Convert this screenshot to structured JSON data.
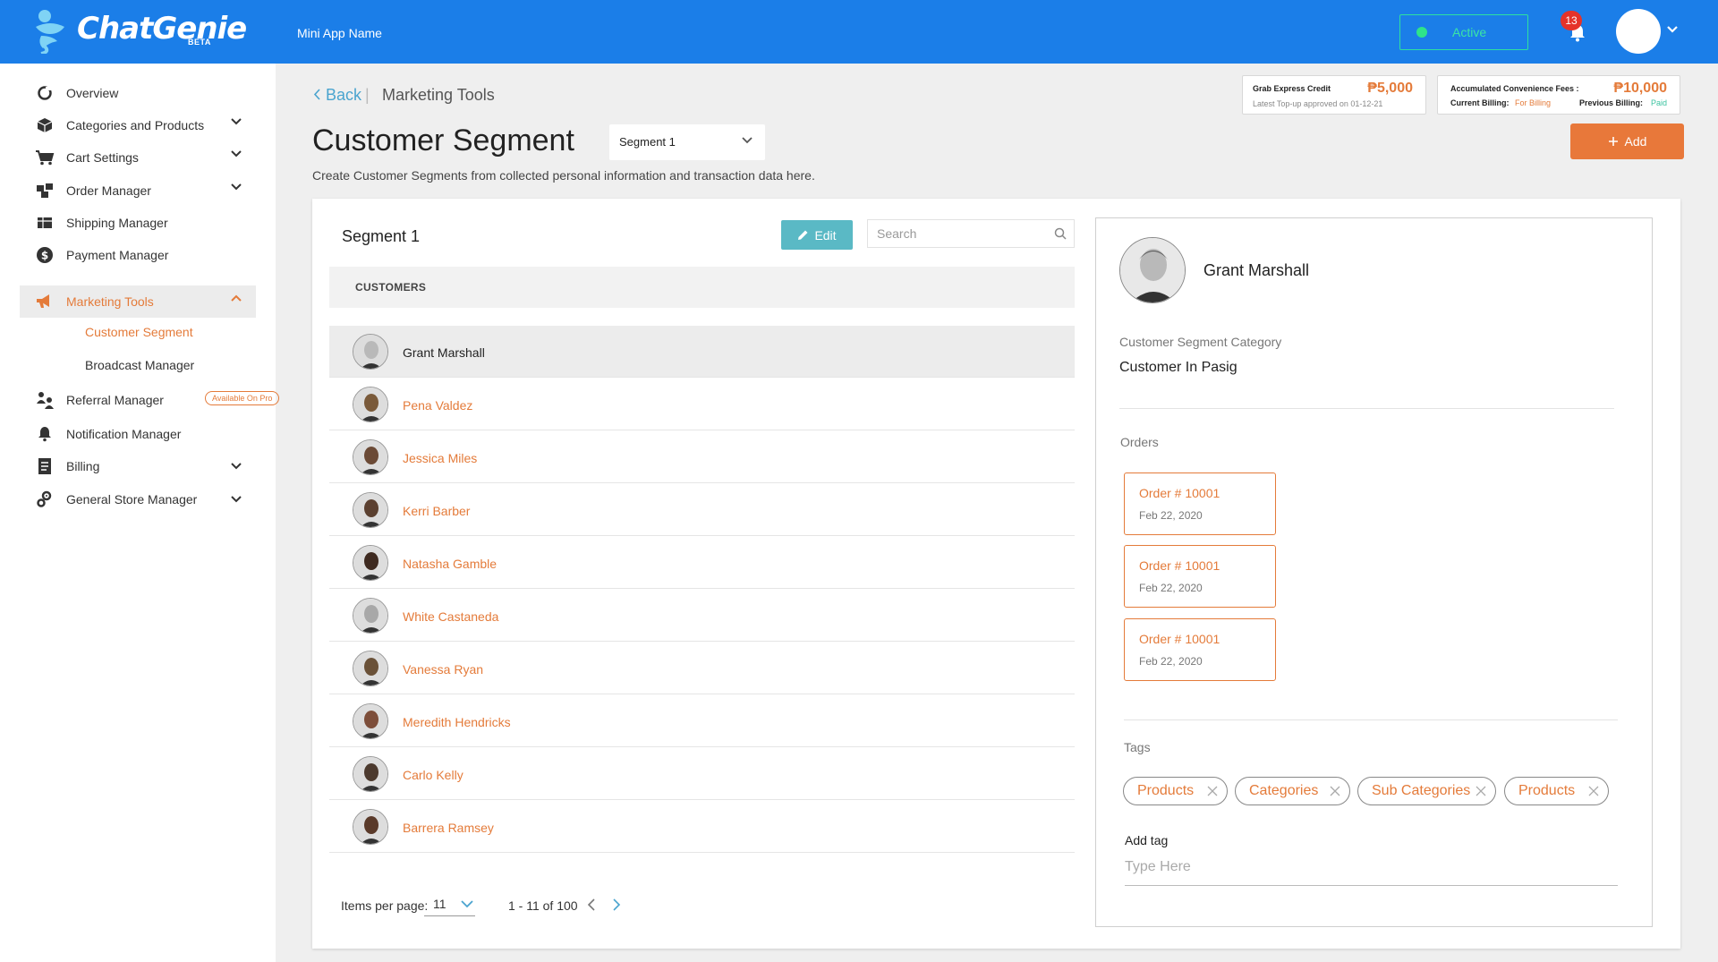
{
  "header": {
    "brand": "ChatGenie",
    "brand_badge": "BETA",
    "app_name": "Mini App Name",
    "status": "Active",
    "notification_count": "13",
    "colors": {
      "bar": "#1b7ee8",
      "status": "#2ee48a",
      "badge": "#e5332a"
    }
  },
  "sidebar": {
    "items": [
      {
        "label": "Overview",
        "icon": "overview-icon"
      },
      {
        "label": "Categories and Products",
        "icon": "box-icon"
      },
      {
        "label": "Cart Settings",
        "icon": "cart-icon"
      },
      {
        "label": "Order Manager",
        "icon": "orders-icon"
      },
      {
        "label": "Shipping Manager",
        "icon": "shipping-icon"
      },
      {
        "label": "Payment Manager",
        "icon": "payment-icon"
      },
      {
        "label": "Marketing Tools",
        "icon": "megaphone-icon"
      },
      {
        "label": "Referral Manager",
        "icon": "referral-icon",
        "badge": "Available On Pro"
      },
      {
        "label": "Notification Manager",
        "icon": "bell-icon"
      },
      {
        "label": "Billing",
        "icon": "billing-icon"
      },
      {
        "label": "General Store Manager",
        "icon": "gears-icon"
      }
    ],
    "subitems": [
      {
        "label": "Customer Segment"
      },
      {
        "label": "Broadcast Manager"
      }
    ],
    "accent": "#e47b3a"
  },
  "breadcrumb": {
    "back": "Back",
    "current": "Marketing Tools"
  },
  "page": {
    "title": "Customer Segment",
    "segment_select": "Segment 1",
    "description": "Create Customer Segments from collected personal information and transaction data here.",
    "add_label": "Add"
  },
  "credits": {
    "grab_label": "Grab Express Credit",
    "grab_amount": "₱5,000",
    "grab_note": "Latest Top-up approved on 01-12-21",
    "fees_label": "Accumulated Convenience Fees :",
    "fees_amount": "₱10,000",
    "current_billing_label": "Current Billing:",
    "current_billing_value": "For Billing",
    "previous_billing_label": "Previous Billing:",
    "previous_billing_value": "Paid"
  },
  "segment": {
    "name": "Segment 1",
    "edit_label": "Edit",
    "search_placeholder": "Search",
    "column_header": "CUSTOMERS",
    "customers": [
      "Grant Marshall",
      "Pena Valdez",
      "Jessica Miles",
      "Kerri Barber",
      "Natasha Gamble",
      "White Castaneda",
      "Vanessa Ryan",
      "Meredith Hendricks",
      "Carlo Kelly",
      "Barrera Ramsey"
    ],
    "pager": {
      "label": "Items per page:",
      "per_page": "11",
      "range": "1 - 11 of 100"
    }
  },
  "detail": {
    "name": "Grant Marshall",
    "category_label": "Customer Segment Category",
    "category_value": "Customer In Pasig",
    "orders_label": "Orders",
    "orders": [
      {
        "number": "Order # 10001",
        "date": "Feb 22, 2020"
      },
      {
        "number": "Order # 10001",
        "date": "Feb 22, 2020"
      },
      {
        "number": "Order # 10001",
        "date": "Feb 22, 2020"
      }
    ],
    "tags_label": "Tags",
    "tags": [
      "Products",
      "Categories",
      "Sub Categories",
      "Products"
    ],
    "add_tag_label": "Add tag",
    "add_tag_placeholder": "Type Here"
  }
}
